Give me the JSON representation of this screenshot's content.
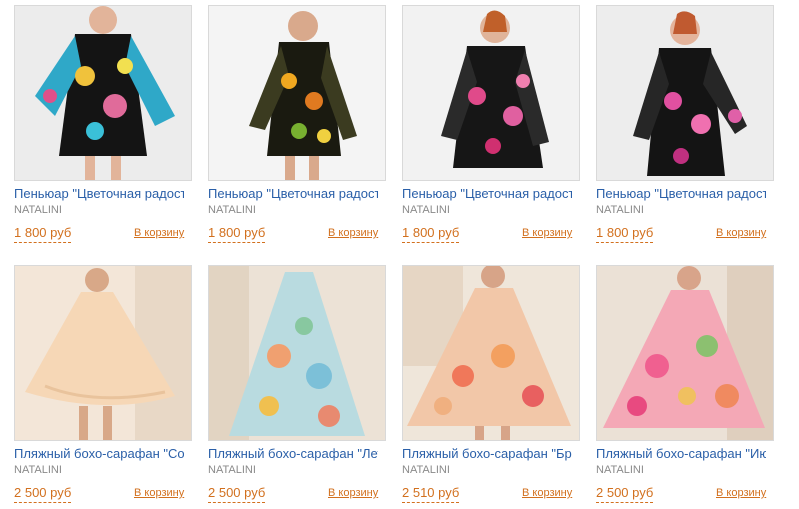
{
  "products": [
    {
      "title": "Пеньюар \"Цветочная радость\"",
      "brand": "NATALINI",
      "price": "1 800 руб",
      "cart": "В корзину",
      "image": "peignoir-turquoise-floral"
    },
    {
      "title": "Пеньюар \"Цветочная радость\"",
      "brand": "NATALINI",
      "price": "1 800 руб",
      "cart": "В корзину",
      "image": "peignoir-yellow-floral"
    },
    {
      "title": "Пеньюар \"Цветочная радость\"",
      "brand": "NATALINI",
      "price": "1 800 руб",
      "cart": "В корзину",
      "image": "peignoir-pink-floral"
    },
    {
      "title": "Пеньюар \"Цветочная радость\"",
      "brand": "NATALINI",
      "price": "1 800 руб",
      "cart": "В корзину",
      "image": "peignoir-orchid-floral"
    },
    {
      "title": "Пляжный бохо-сарафан \"Солнце\"",
      "brand": "NATALINI",
      "price": "2 500 руб",
      "cart": "В корзину",
      "image": "boho-sundress-peach"
    },
    {
      "title": "Пляжный бохо-сарафан \"Лето\"",
      "brand": "NATALINI",
      "price": "2 500 руб",
      "cart": "В корзину",
      "image": "boho-sundress-blue"
    },
    {
      "title": "Пляжный бохо-сарафан \"Бриз\"",
      "brand": "NATALINI",
      "price": "2 510 руб",
      "cart": "В корзину",
      "image": "boho-sundress-coral"
    },
    {
      "title": "Пляжный бохо-сарафан \"Июль\"",
      "brand": "NATALINI",
      "price": "2 500 руб",
      "cart": "В корзину",
      "image": "boho-sundress-pink"
    }
  ]
}
